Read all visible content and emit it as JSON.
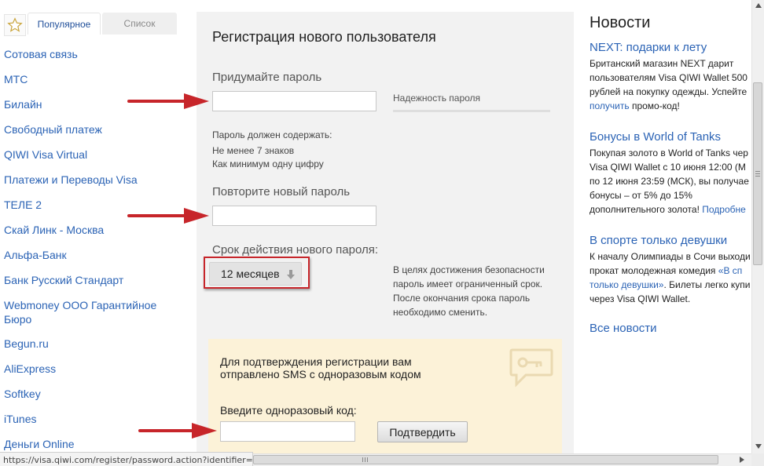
{
  "tabs": {
    "popular_label": "Популярное",
    "list_label": "Список"
  },
  "sidebar": {
    "items": [
      {
        "label": "Сотовая связь"
      },
      {
        "label": "МТС"
      },
      {
        "label": "Билайн"
      },
      {
        "label": "Свободный платеж"
      },
      {
        "label": "QIWI Visa Virtual"
      },
      {
        "label": "Платежи и Переводы Visa"
      },
      {
        "label": "ТЕЛЕ 2"
      },
      {
        "label": "Скай Линк - Москва"
      },
      {
        "label": "Альфа-Банк"
      },
      {
        "label": "Банк Русский Стандарт"
      },
      {
        "label": "Webmoney ООО Гарантийное Бюро"
      },
      {
        "label": "Begun.ru"
      },
      {
        "label": "AliExpress"
      },
      {
        "label": "Softkey"
      },
      {
        "label": "iTunes"
      },
      {
        "label": "Деньги Online"
      }
    ]
  },
  "form": {
    "title": "Регистрация нового пользователя",
    "password_label": "Придумайте пароль",
    "password_value": "",
    "strength_label": "Надежность пароля",
    "rules_title": "Пароль должен содержать:",
    "rule_1": "Не менее 7 знаков",
    "rule_2": "Как минимум одну цифру",
    "repeat_label": "Повторите новый пароль",
    "repeat_value": "",
    "expiry_label": "Срок действия нового пароля:",
    "expiry_selected": "12 месяцев",
    "expiry_hint_1": "В целях достижения безопасности",
    "expiry_hint_2": "пароль имеет ограниченный срок.",
    "expiry_hint_3": "После окончания срока пароль",
    "expiry_hint_4": "необходимо сменить."
  },
  "sms": {
    "text_1": "Для подтверждения регистрации вам",
    "text_2": "отправлено SMS с одноразовым кодом",
    "code_label": "Введите одноразовый код:",
    "code_value": "",
    "confirm_label": "Подтвердить"
  },
  "news": {
    "heading": "Новости",
    "items": [
      {
        "title": "NEXT: подарки к лету",
        "lines": [
          "Британский магазин NEXT дарит",
          "пользователям Visa QIWI Wallet 500",
          "рублей на покупку одежды. Успейте"
        ],
        "link_part": "получить",
        "tail": " промо-код!"
      },
      {
        "title": "Бонусы в World of Tanks",
        "lines": [
          "Покупая золото в World of Tanks чер",
          "Visa QIWI Wallet с 10 июня 12:00 (М",
          "по 12 июня 23:59 (МСК), вы получае",
          "бонусы – от 5% до 15%"
        ],
        "last_plain": "дополнительного золота! ",
        "last_link": "Подробне"
      },
      {
        "title": "В спорте только девушки",
        "line_1": "К началу Олимпиады в Сочи выходи",
        "line_2_plain": "прокат молодежная комедия ",
        "line_2_link": "«В сп",
        "line_3_link": "только девушки»",
        "line_3_plain": ". Билеты легко купи",
        "line_4": "через Visa QIWI Wallet."
      }
    ],
    "all_news": "Все новости"
  },
  "status_bar": {
    "url": "https://visa.qiwi.com/register/password.action?identifier=..."
  },
  "colors": {
    "link": "#2b63b5",
    "panel": "#f2f2f2",
    "sms_background": "#fcf2d8",
    "annotation_red": "#c7252a"
  }
}
